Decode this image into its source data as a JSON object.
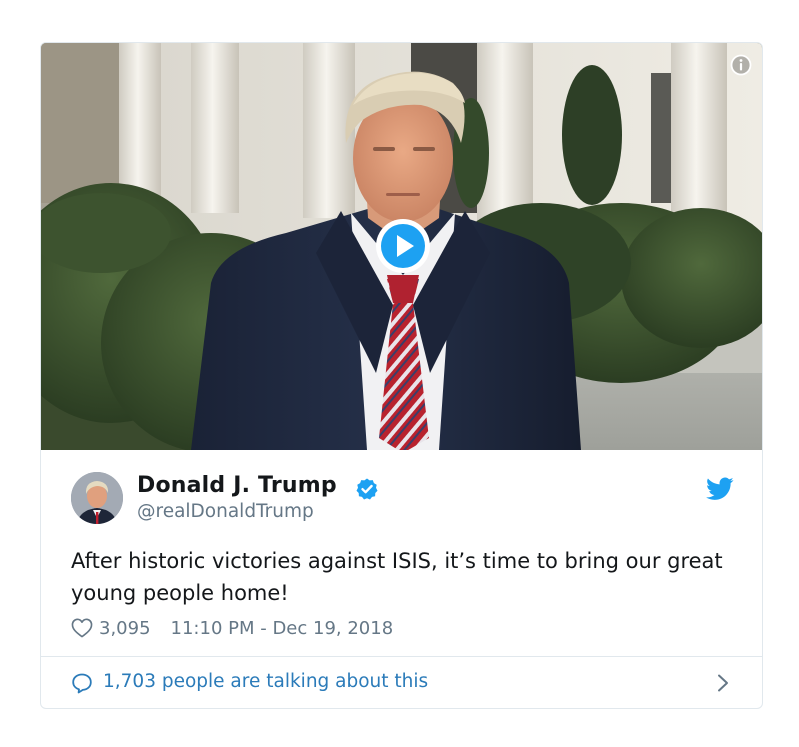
{
  "tweet": {
    "author": {
      "display_name": "Donald J. Trump",
      "handle": "@realDonaldTrump",
      "verified": true,
      "avatar": "avatar-photo"
    },
    "text": "After historic victories against ISIS, it’s time to bring our great young people home!",
    "likes": "3,095",
    "timestamp": "11:10 PM - Dec 19, 2018",
    "media": {
      "type": "video",
      "play_icon": "play-icon",
      "info_icon": "info-icon"
    }
  },
  "footer": {
    "talking_text": "1,703 people are talking about this",
    "reply_icon": "reply-icon",
    "chevron_icon": "chevron-right-icon"
  },
  "colors": {
    "accent": "#1da1f2",
    "link": "#2b7bb9",
    "text": "#14171a",
    "muted": "#657786",
    "border": "#e1e8ed"
  }
}
